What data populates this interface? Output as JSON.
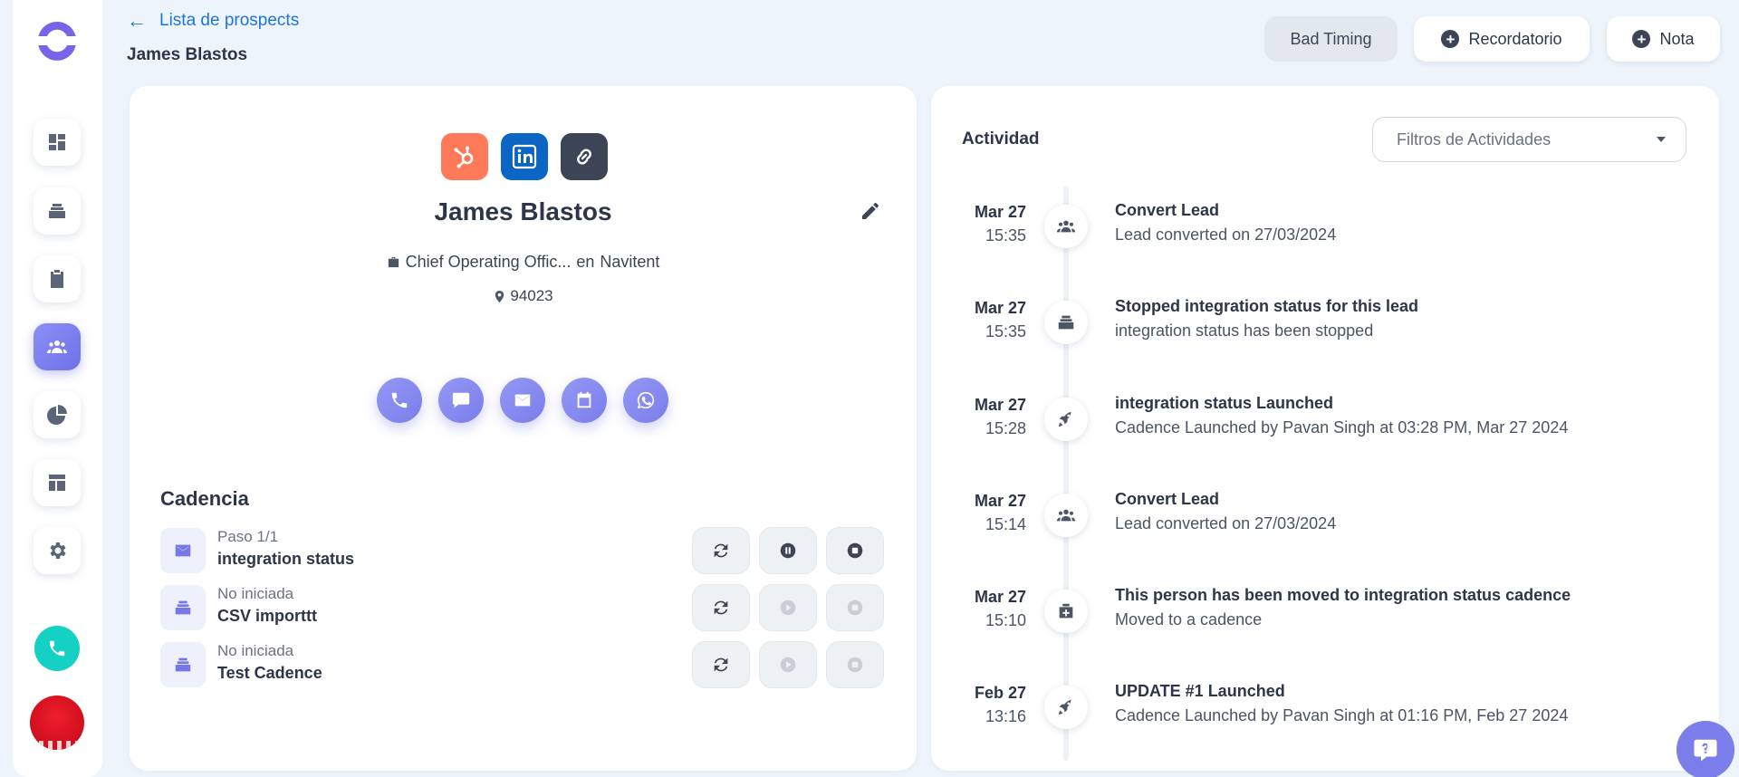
{
  "header": {
    "back_label": "Lista de prospects",
    "title": "James Blastos",
    "buttons": {
      "bad_timing": "Bad Timing",
      "reminder": "Recordatorio",
      "note": "Nota"
    }
  },
  "profile": {
    "name": "James Blastos",
    "job_title": "Chief Operating Offic...",
    "job_connector": "en",
    "company": "Navitent",
    "location": "94023",
    "integrations": [
      "hubspot-icon",
      "linkedin-icon",
      "link-icon"
    ]
  },
  "cadence": {
    "title": "Cadencia",
    "items": [
      {
        "status": "Paso 1/1",
        "name": "integration status",
        "icon": "email-icon",
        "active": true
      },
      {
        "status": "No iniciada",
        "name": "CSV importtt",
        "icon": "layers-icon",
        "active": false
      },
      {
        "status": "No iniciada",
        "name": "Test Cadence",
        "icon": "layers-icon",
        "active": false
      }
    ]
  },
  "activity": {
    "title": "Actividad",
    "filter_label": "Filtros de Actividades",
    "events": [
      {
        "date": "Mar 27",
        "time": "15:35",
        "icon": "people-icon",
        "title": "Convert Lead",
        "desc": "Lead converted on 27/03/2024"
      },
      {
        "date": "Mar 27",
        "time": "15:35",
        "icon": "layers-icon",
        "title": "Stopped integration status for this lead",
        "desc": "integration status has been stopped"
      },
      {
        "date": "Mar 27",
        "time": "15:28",
        "icon": "rocket-icon",
        "title": "integration status Launched",
        "desc": "Cadence Launched by Pavan Singh at 03:28 PM, Mar 27 2024"
      },
      {
        "date": "Mar 27",
        "time": "15:14",
        "icon": "people-icon",
        "title": "Convert Lead",
        "desc": "Lead converted on 27/03/2024"
      },
      {
        "date": "Mar 27",
        "time": "15:10",
        "icon": "move-icon",
        "title": "This person has been moved to integration status cadence",
        "desc": "Moved to a cadence"
      },
      {
        "date": "Feb 27",
        "time": "13:16",
        "icon": "rocket-icon",
        "title": "UPDATE #1 Launched",
        "desc": "Cadence Launched by Pavan Singh at 01:16 PM, Feb 27 2024"
      }
    ]
  },
  "colors": {
    "accent": "#7a7dea",
    "link": "#1f74d8",
    "hubspot": "#ff7a59",
    "linkedin": "#0a66c2",
    "link_icon": "#3b4556",
    "phone": "#14d1c3"
  }
}
